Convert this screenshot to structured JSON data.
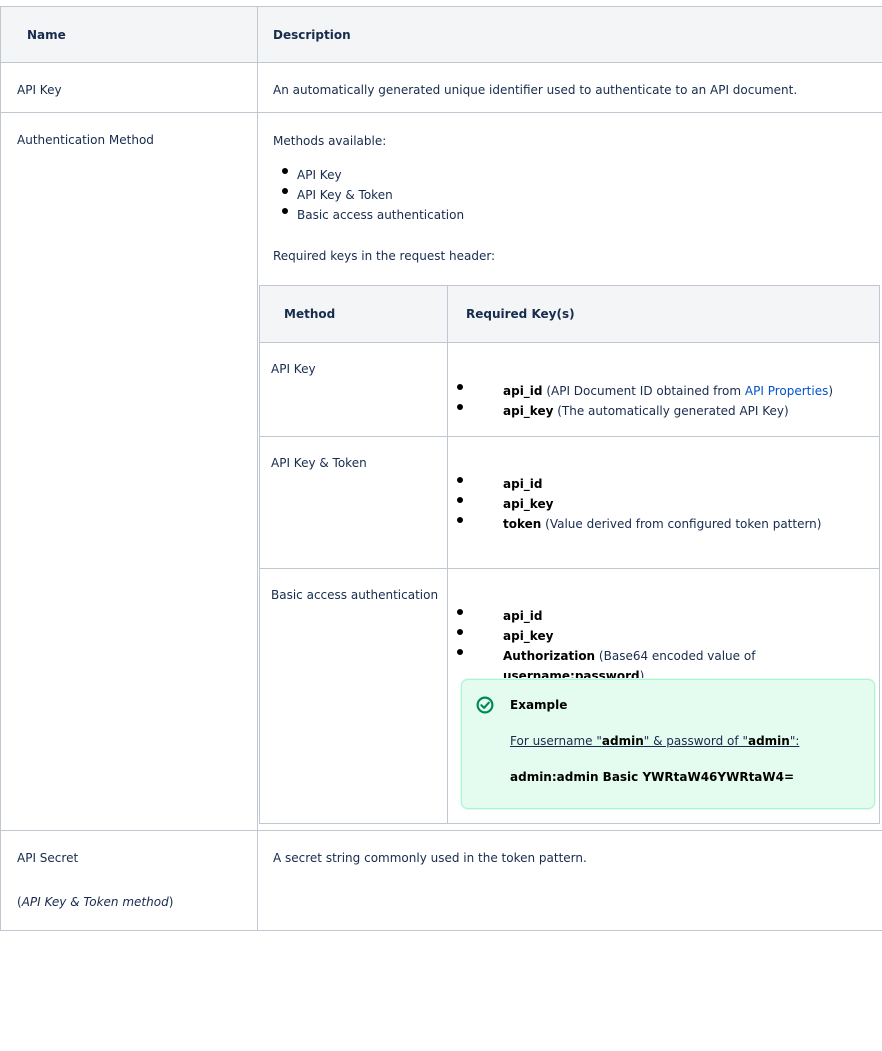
{
  "headers": {
    "name": "Name",
    "description": "Description"
  },
  "rows": {
    "api_key": {
      "name": "API Key",
      "desc": "An automatically generated unique identifier used to authenticate to an API document."
    },
    "auth": {
      "name": "Authentication Method",
      "methods_intro": "Methods available:",
      "methods": [
        "API Key",
        "API Key & Token",
        "Basic access authentication"
      ],
      "required_intro": "Required keys in the request header:",
      "inner_headers": {
        "method": "Method",
        "keys": "Required Key(s)"
      },
      "inner": {
        "r1": {
          "method": "API Key",
          "k1_name": "api_id",
          "k1_pre": " (API Document ID obtained from ",
          "k1_link": "API Properties",
          "k1_post": ")",
          "k2_name": "api_key",
          "k2_desc": " (The automatically generated API Key)"
        },
        "r2": {
          "method": "API Key & Token",
          "k1_name": "api_id",
          "k2_name": "api_key",
          "k3_name": "token",
          "k3_desc": " (Value derived from configured token pattern)"
        },
        "r3": {
          "method": "Basic access authentication",
          "k1_name": "api_id",
          "k2_name": "api_key",
          "k3_name": "Authorization",
          "k3_pre": " (Base64 encoded value of ",
          "k3_bold": "username:password",
          "k3_post": ")",
          "panel": {
            "title": "Example",
            "line_pre": "For username \"",
            "line_user": "admin",
            "line_mid": "\" & password of \"",
            "line_pass": "admin",
            "line_post": "\":",
            "code": "admin:admin  Basic YWRtaW46YWRtaW4="
          }
        }
      }
    },
    "secret": {
      "name": "API Secret",
      "note": "API Key & Token method",
      "desc": "A secret string commonly used in the token pattern."
    }
  },
  "colors": {
    "header_bg": "#f4f5f7",
    "border": "#c1c7d0",
    "link": "#0052cc",
    "success_panel": "#e3fcef",
    "success_icon": "#00875a"
  },
  "icons": {
    "panel": "check-circle-icon"
  }
}
